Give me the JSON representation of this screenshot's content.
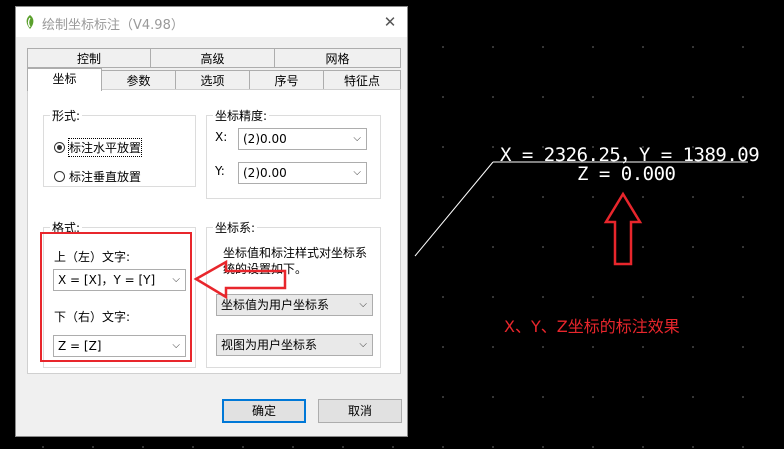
{
  "dialog": {
    "title": "绘制坐标标注（V4.98）",
    "close_glyph": "✕",
    "tabs_top": [
      "控制",
      "高级",
      "网格"
    ],
    "tabs_bottom": [
      "坐标",
      "参数",
      "选项",
      "序号",
      "特征点"
    ],
    "active_tab": "坐标",
    "form_group": {
      "label": "形式:",
      "options": [
        "标注水平放置",
        "标注垂直放置"
      ],
      "selected": "标注水平放置"
    },
    "precision_group": {
      "label": "坐标精度:",
      "x_label": "X:",
      "x_value": "(2)0.00",
      "y_label": "Y:",
      "y_value": "(2)0.00"
    },
    "format_group": {
      "label": "格式:",
      "upper_label": "上（左）文字:",
      "upper_value": "X = [X]，Y = [Y]",
      "lower_label": "下（右）文字:",
      "lower_value": "Z = [Z]"
    },
    "coord_group": {
      "label": "坐标系:",
      "description": "坐标值和标注样式对坐标系统的设置如下。",
      "value_system": "坐标值为用户坐标系",
      "view_system": "视图为用户坐标系"
    },
    "ok_label": "确定",
    "cancel_label": "取消"
  },
  "canvas": {
    "annotation_line1": "X = 2326.25，Y = 1389.09",
    "annotation_line2": "Z = 0.000",
    "effect_label": "X、Y、Z坐标的标注效果",
    "highlight_color": "#e8262c"
  },
  "icons": {
    "app": "app-logo-icon",
    "close": "close-icon",
    "dropdown": "chevron-down-icon",
    "arrow_left": "left-arrow-icon",
    "arrow_up": "up-arrow-icon"
  }
}
